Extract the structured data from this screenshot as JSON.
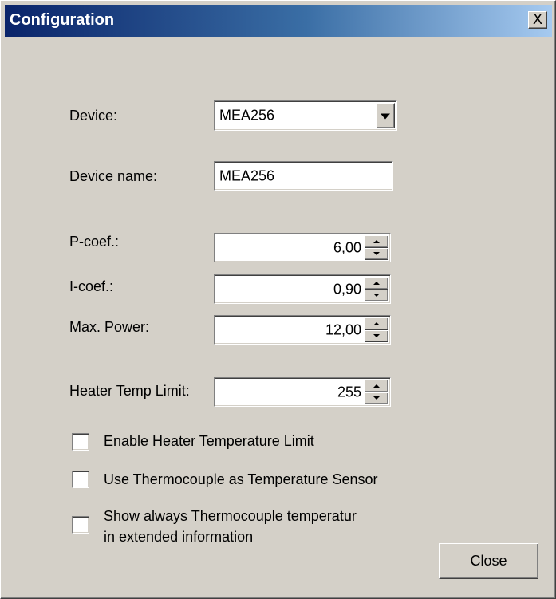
{
  "window": {
    "title": "Configuration",
    "close_glyph": "X"
  },
  "device": {
    "label": "Device:",
    "value": "MEA256"
  },
  "device_name": {
    "label": "Device name:",
    "value": "MEA256"
  },
  "p_coef": {
    "label": "P-coef.:",
    "value": "6,00"
  },
  "i_coef": {
    "label": "I-coef.:",
    "value": "0,90"
  },
  "max_power": {
    "label": "Max. Power:",
    "value": "12,00"
  },
  "heater_temp_limit": {
    "label": "Heater Temp Limit:",
    "value": "255"
  },
  "checkboxes": {
    "enable_limit": {
      "label": "Enable Heater Temperature Limit",
      "checked": false
    },
    "use_thermocouple": {
      "label": "Use Thermocouple as Temperature Sensor",
      "checked": false
    },
    "show_thermocouple_line1": "Show always Thermocouple temperatur",
    "show_thermocouple_line2": "in extended information",
    "show_thermocouple_checked": false
  },
  "buttons": {
    "close_label": "Close"
  },
  "icons": {
    "close": "close-icon",
    "dropdown": "chevron-down-icon",
    "spin_up": "spin-up-icon",
    "spin_down": "spin-down-icon"
  }
}
